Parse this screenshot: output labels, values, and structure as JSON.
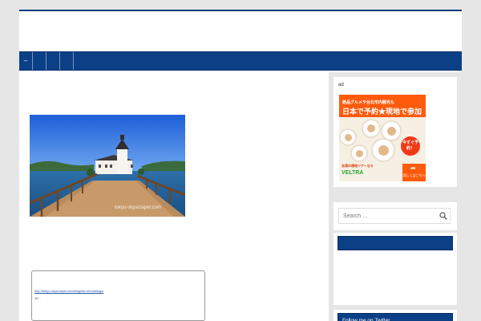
{
  "nav": {
    "items": [
      {
        "label": "–"
      },
      {
        "label": ""
      },
      {
        "label": ""
      },
      {
        "label": ""
      }
    ]
  },
  "post": {
    "image_watermark": "tokyo-skyscraper.com",
    "link_url": "http://tokyo-skyscraper.com/blog/list-of-buildings/",
    "link_count": "10..."
  },
  "sidebar": {
    "ad_label": "ad",
    "ad": {
      "line1": "絶品グルメや台北市内観光も",
      "line2": "日本で予約★現地で参加",
      "badge": "今すぐ予約！",
      "sub": "台湾の現地ツアーなら",
      "logo": "VELTRA",
      "cta": "詳しくはこちら"
    },
    "search_placeholder": "Search ...",
    "widget_blank_title": "",
    "twitter_title": "Follow me on Twitter"
  },
  "colors": {
    "nav_blue": "#0b3f86",
    "page_bg": "#e6e6e6",
    "ad_orange": "#ff5b0d"
  }
}
